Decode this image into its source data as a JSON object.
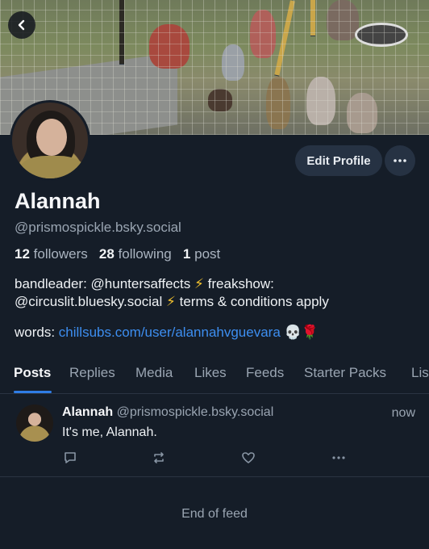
{
  "header": {
    "back_icon": "chevron-left-icon"
  },
  "profile": {
    "edit_label": "Edit Profile",
    "more_icon": "ellipsis-icon",
    "name": "Alannah",
    "handle": "@prismospickle.bsky.social",
    "followers_count": "12",
    "followers_label": "followers",
    "following_count": "28",
    "following_label": "following",
    "posts_count": "1",
    "posts_label": "post",
    "bio_part1": "bandleader: @huntersaffects ",
    "bio_part2": " freakshow:",
    "bio_part3": "@circuslit.bluesky.social ",
    "bio_part4": " terms & conditions apply",
    "bolt": "⚡",
    "words_label": "words: ",
    "words_link": "chillsubs.com/user/alannahvguevara",
    "words_emoji": "💀🌹"
  },
  "tabs": [
    {
      "label": "Posts",
      "active": true
    },
    {
      "label": "Replies"
    },
    {
      "label": "Media"
    },
    {
      "label": "Likes"
    },
    {
      "label": "Feeds"
    },
    {
      "label": "Starter Packs"
    },
    {
      "label": "Lis"
    }
  ],
  "post": {
    "author": "Alannah",
    "handle": "@prismospickle.bsky.social",
    "time": "now",
    "text": "It's me, Alannah.",
    "actions": [
      "reply-icon",
      "repost-icon",
      "like-icon",
      "ellipsis-icon"
    ]
  },
  "feed": {
    "end_text": "End of feed"
  },
  "colors": {
    "background": "#151d28",
    "accent": "#2f7de6",
    "link": "#3d8ef0",
    "muted": "#9aa5b2"
  }
}
